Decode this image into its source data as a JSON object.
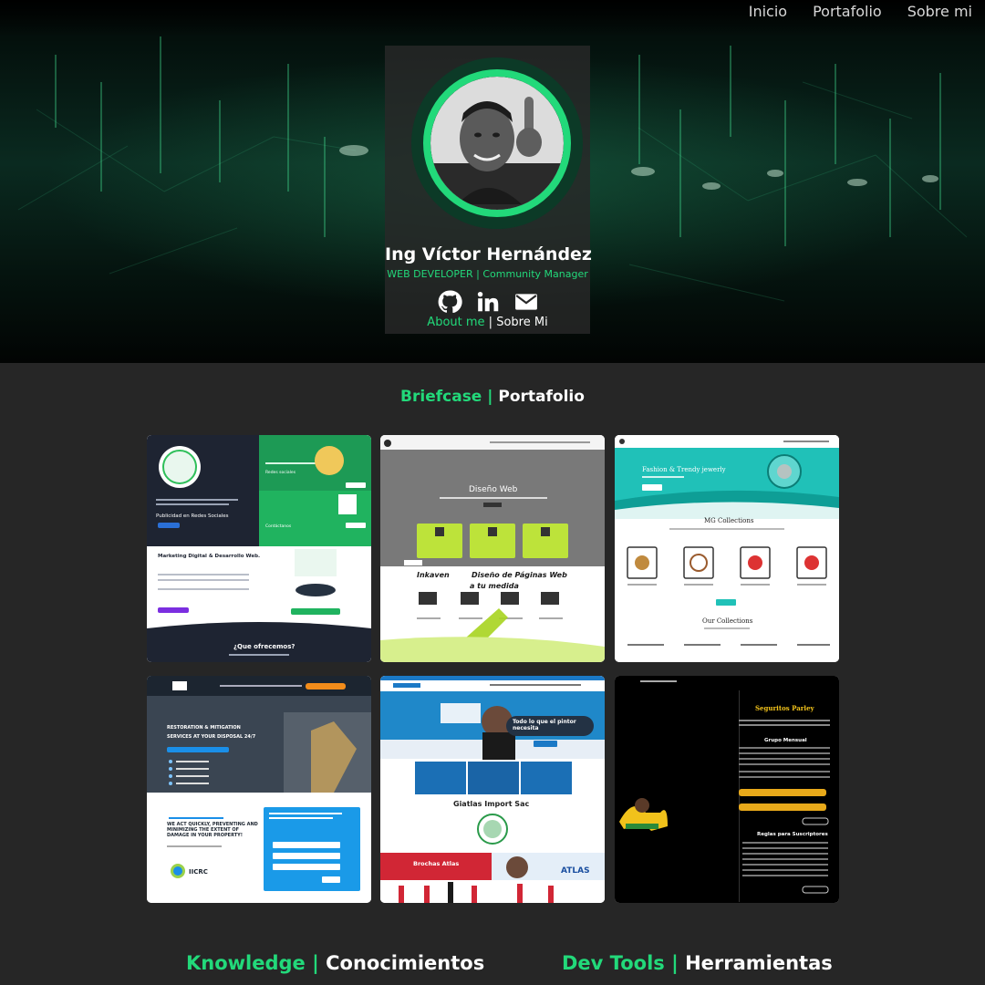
{
  "nav": {
    "items": [
      "Inicio",
      "Portafolio",
      "Sobre mi"
    ]
  },
  "profile": {
    "name": "Ing Víctor Hernández",
    "role": "WEB DEVELOPER | Community Manager",
    "about_en": "About me",
    "separator": "|",
    "about_es": "Sobre Mi",
    "social_icons": [
      "github-icon",
      "linkedin-icon",
      "mail-icon"
    ]
  },
  "portfolio": {
    "title_en": "Briefcase",
    "separator": "|",
    "title_es": "Portafolio",
    "projects": [
      {
        "name": "inkaven-social",
        "texts": [
          "Publicidad en Redes Sociales",
          "Marketing Digital & Desarrollo Web.",
          "¿Que ofrecemos?",
          "Redes sociales",
          "Contáctanos"
        ]
      },
      {
        "name": "inkaven-web",
        "texts": [
          "Diseño Web",
          "Inkaven",
          "Diseño de Páginas Web",
          "a tu medida"
        ]
      },
      {
        "name": "mg-collections",
        "texts": [
          "Fashion & Trendy jewerly",
          "MG Collections",
          "Our Collections"
        ]
      },
      {
        "name": "restoration",
        "texts": [
          "RESTORATION & MITIGATION",
          "SERVICES AT YOUR DISPOSAL 24/7",
          "WE ACT QUICKLY, PREVENTING AND MINIMIZING THE EXTENT OF DAMAGE IN YOUR PROPERTY!",
          "IICRC"
        ]
      },
      {
        "name": "giatlas",
        "texts": [
          "Todo lo que el pintor necesita",
          "Giatlas Import Sac",
          "Brochas Atlas",
          "ATLAS"
        ]
      },
      {
        "name": "seguritos",
        "texts": [
          "Seguritos Parley",
          "Grupo Mensual",
          "Reglas para Suscriptores"
        ]
      }
    ]
  },
  "sections": {
    "knowledge_en": "Knowledge",
    "knowledge_sep": "|",
    "knowledge_es": "Conocimientos",
    "tools_en": "Dev Tools",
    "tools_sep": "|",
    "tools_es": "Herramientas"
  },
  "colors": {
    "accent": "#22d97a",
    "background": "#262626",
    "card": "#282828"
  }
}
